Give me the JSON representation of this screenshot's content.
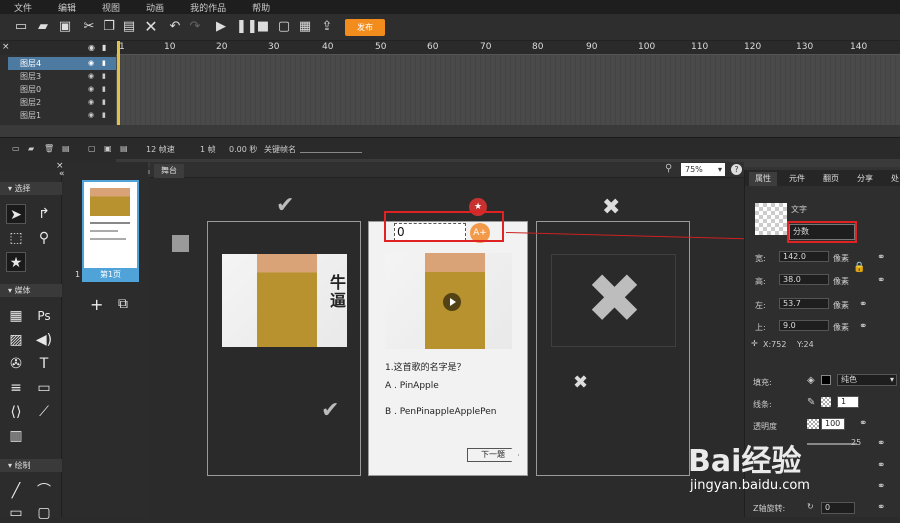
{
  "menu": [
    "文件",
    "编辑",
    "视图",
    "动画",
    "我的作品",
    "帮助"
  ],
  "toolbar": {
    "publish_label": "发布"
  },
  "timeline": {
    "ruler": [
      "10",
      "20",
      "30",
      "40",
      "50",
      "60",
      "70",
      "80",
      "90",
      "100",
      "110",
      "120",
      "130",
      "140"
    ],
    "ruler_first": "1",
    "layers": [
      "图层4",
      "图层3",
      "图层0",
      "图层2",
      "图层1"
    ]
  },
  "status": {
    "fps": "12 帧速",
    "frame": "1 帧",
    "time": "0.00 秒",
    "keyframe": "关键帧名"
  },
  "left_panel": {
    "select_title": "选择",
    "media_title": "媒体",
    "draw_title": "绘制"
  },
  "pages": {
    "page_label": "第1页",
    "page_number": "1"
  },
  "stage": {
    "tab_label": "舞台",
    "zoom": "75%",
    "input_value": "0",
    "question": "1.这首歌的名字是？",
    "option_a": "A . PinApple",
    "option_b": "B . PenPinappleApplePen",
    "next_button": "下一题",
    "side_text": "牛\n逼"
  },
  "properties": {
    "tabs": [
      "属性",
      "元件",
      "翻页",
      "分享",
      "处"
    ],
    "text_label": "文字",
    "name_value": "分数",
    "width_label": "宽:",
    "width_value": "142.0",
    "width_unit": "像素",
    "height_label": "高:",
    "height_value": "38.0",
    "height_unit": "像素",
    "left_label": "左:",
    "left_value": "53.7",
    "left_unit": "像素",
    "top_label": "上:",
    "top_value": "9.0",
    "top_unit": "像素",
    "xcoord": "X:752",
    "ycoord": "Y:24",
    "fill_label": "填充:",
    "fill_type": "纯色",
    "line_label": "线条:",
    "line_value": "1",
    "opacity_label": "透明度",
    "opacity_value": "100",
    "rotate_value": "25",
    "zrot_label": "Z轴旋转:",
    "zrot_value": "0"
  },
  "watermark": {
    "text": "Bai经验",
    "url": "jingyan.baidu.com"
  }
}
